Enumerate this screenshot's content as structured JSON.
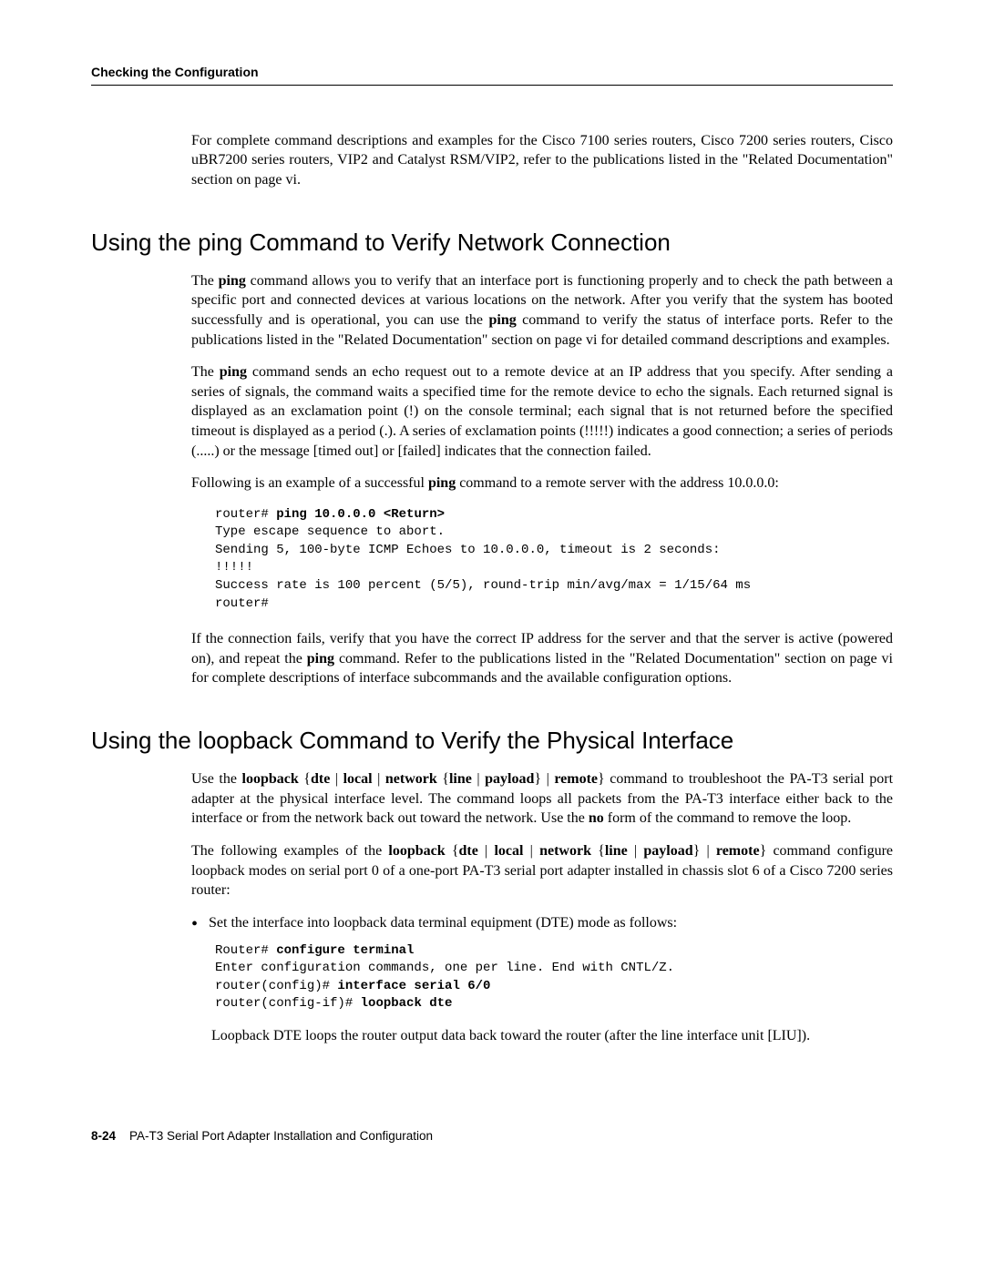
{
  "header": {
    "section": "Checking the Configuration"
  },
  "intro_para": "For complete command descriptions and examples for the Cisco 7100 series routers, Cisco 7200 series routers, Cisco uBR7200 series routers, VIP2 and Catalyst RSM/VIP2, refer to the publications listed in the \"Related Documentation\" section on page vi.",
  "ping_section": {
    "heading": "Using the ping Command to Verify Network Connection",
    "para1_pre": "The ",
    "para1_bold1": "ping",
    "para1_mid": " command allows you to verify that an interface port is functioning properly and to check the path between a specific port and connected devices at various locations on the network. After you verify that the system has booted successfully and is operational, you can use the ",
    "para1_bold2": "ping",
    "para1_post": " command to verify the status of interface ports. Refer to the publications listed in the \"Related Documentation\" section on page vi for detailed command descriptions and examples.",
    "para2_pre": "The ",
    "para2_bold": "ping",
    "para2_post": " command sends an echo request out to a remote device at an IP address that you specify. After sending a series of signals, the command waits a specified time for the remote device to echo the signals. Each returned signal is displayed as an exclamation point (!) on the console terminal; each signal that is not returned before the specified timeout is displayed as a period (.). A series of exclamation points (!!!!!) indicates a good connection; a series of periods (.....) or the message [timed out] or [failed] indicates that the connection failed.",
    "para3_pre": "Following is an example of a successful ",
    "para3_bold": "ping",
    "para3_post": " command to a remote server with the address 10.0.0.0:",
    "code_l1_pre": "router# ",
    "code_l1_bold": "ping 10.0.0.0 <Return>",
    "code_l2": "Type escape sequence to abort.",
    "code_l3": "Sending 5, 100-byte ICMP Echoes to 10.0.0.0, timeout is 2 seconds:",
    "code_l4": "!!!!!",
    "code_l5": "Success rate is 100 percent (5/5), round-trip min/avg/max = 1/15/64 ms",
    "code_l6": "router#",
    "para4_pre": "If the connection fails, verify that you have the correct IP address for the server and that the server is active (powered on), and repeat the ",
    "para4_bold": "ping",
    "para4_post": " command. Refer to the publications listed in the \"Related Documentation\" section on page vi for complete descriptions of interface subcommands and the available configuration options."
  },
  "loopback_section": {
    "heading": "Using the loopback Command to Verify the Physical Interface",
    "para1_pre": "Use the ",
    "para1_b1": "loopback",
    "para1_t1": " {",
    "para1_b2": "dte",
    "para1_t2": " | ",
    "para1_b3": "local",
    "para1_t3": " | ",
    "para1_b4": "network",
    "para1_t4": " {",
    "para1_b5": "line",
    "para1_t5": " | ",
    "para1_b6": "payload",
    "para1_t6": "} | ",
    "para1_b7": "remote",
    "para1_t7": "} command to troubleshoot the PA-T3 serial port adapter at the physical interface level. The command loops all packets from the PA-T3 interface either back to the interface or from the network back out toward the network. Use the ",
    "para1_b8": "no",
    "para1_t8": " form of the command to remove the loop.",
    "para2_pre": "The following examples of the ",
    "para2_b1": "loopback",
    "para2_t1": " {",
    "para2_b2": "dte",
    "para2_t2": " | ",
    "para2_b3": "local",
    "para2_t3": " | ",
    "para2_b4": "network",
    "para2_t4": " {",
    "para2_b5": "line",
    "para2_t5": " | ",
    "para2_b6": "payload",
    "para2_t6": "} | ",
    "para2_b7": "remote",
    "para2_t7": "} command configure loopback modes on serial port 0 of a one-port PA-T3 serial port adapter installed in chassis slot 6 of a Cisco 7200 series router:",
    "bullet1": "Set the interface into loopback data terminal equipment (DTE) mode as follows:",
    "code2_l1_pre": "Router# ",
    "code2_l1_bold": "configure terminal",
    "code2_l2": "Enter configuration commands, one per line. End with CNTL/Z.",
    "code2_l3_pre": "router(config)# ",
    "code2_l3_bold": "interface serial 6/0",
    "code2_l4_pre": "router(config-if)# ",
    "code2_l4_bold": "loopback dte",
    "bullet1_followup": "Loopback DTE loops the router output data back toward the router (after the line interface unit [LIU])."
  },
  "footer": {
    "pagenum": "8-24",
    "title": "PA-T3 Serial Port Adapter Installation and Configuration"
  }
}
